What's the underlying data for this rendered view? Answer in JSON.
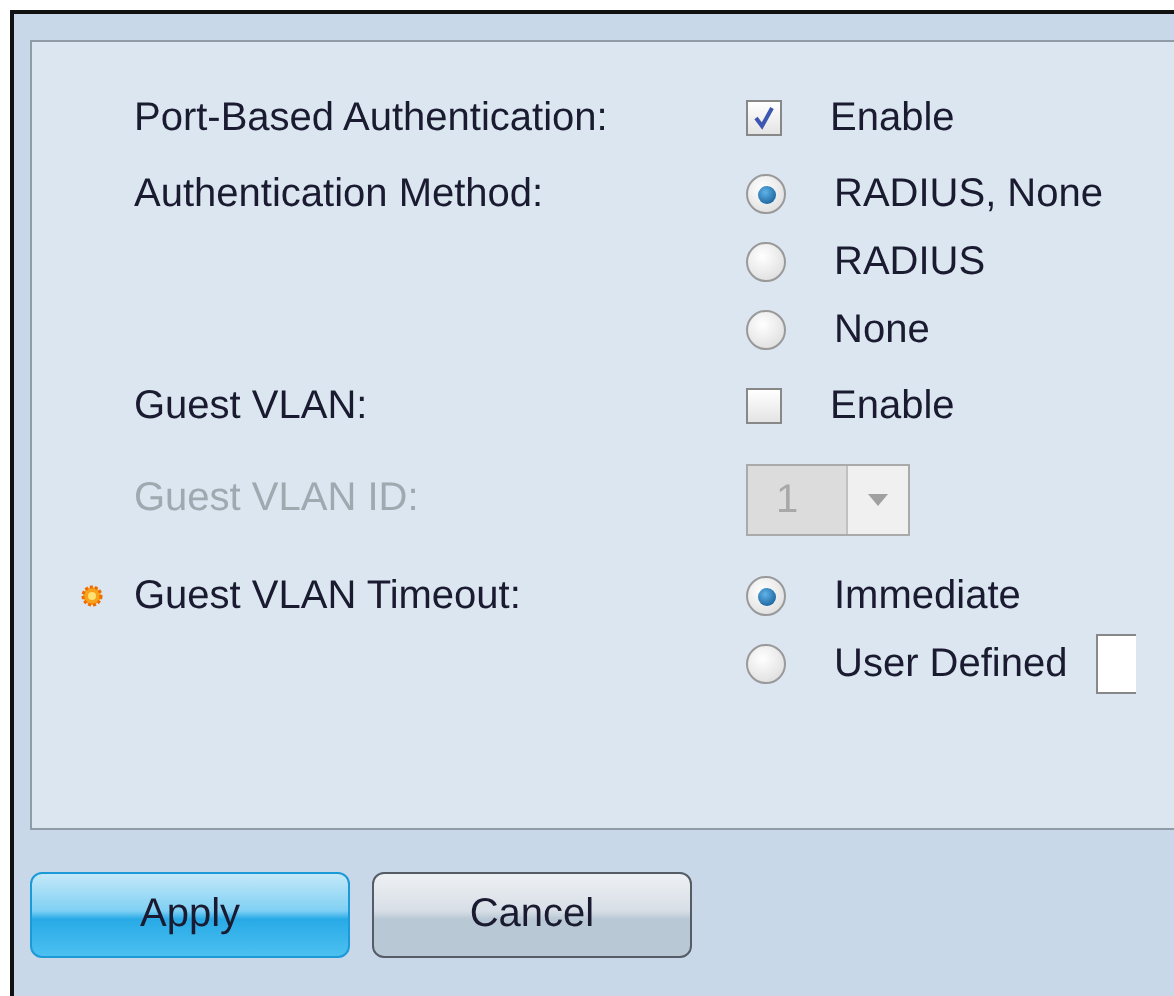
{
  "fields": [
    {
      "label": "Port-Based Authentication:",
      "kind": "checkbox",
      "required": false,
      "disabled": false,
      "option": "Enable",
      "checked": true
    },
    {
      "label": "Authentication Method:",
      "kind": "radio",
      "required": false,
      "disabled": false,
      "options": [
        {
          "label": "RADIUS, None",
          "selected": true,
          "input": false
        },
        {
          "label": "RADIUS",
          "selected": false,
          "input": false
        },
        {
          "label": "None",
          "selected": false,
          "input": false
        }
      ]
    },
    {
      "label": "Guest VLAN:",
      "kind": "checkbox",
      "required": false,
      "disabled": false,
      "option": "Enable",
      "checked": false
    },
    {
      "label": "Guest VLAN ID:",
      "kind": "select",
      "required": false,
      "disabled": true,
      "value": "1"
    },
    {
      "label": "Guest VLAN Timeout:",
      "kind": "radio",
      "required": true,
      "disabled": false,
      "options": [
        {
          "label": "Immediate",
          "selected": true,
          "input": false
        },
        {
          "label": "User Defined",
          "selected": false,
          "input": true
        }
      ]
    }
  ],
  "buttons": [
    {
      "label": "Apply",
      "primary": true
    },
    {
      "label": "Cancel",
      "primary": false
    }
  ]
}
